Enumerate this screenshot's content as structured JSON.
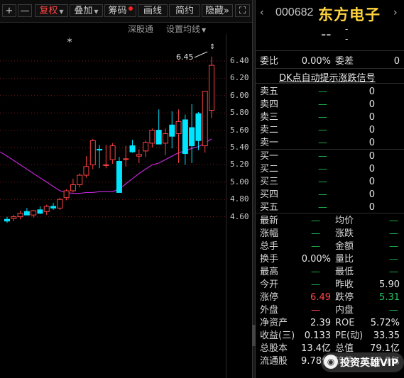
{
  "toolbar": {
    "plus": "+",
    "minus": "—",
    "fuquan": "复权",
    "diejia": "叠加",
    "chouma": "筹码",
    "huaxian": "画线",
    "jianyue": "简约",
    "yincang": "隐藏",
    "more": "»",
    "fullscreen": "⛶"
  },
  "subbar": {
    "shengutong": "深股通",
    "setting": "设置均线"
  },
  "chart": {
    "y_ticks": [
      "6.40",
      "6.20",
      "6.00",
      "5.80",
      "5.60",
      "5.40",
      "5.20",
      "5.00",
      "4.80",
      "4.60"
    ],
    "high_label": "6.45",
    "star": "*",
    "chart_data": {
      "type": "candlestick",
      "ylim": [
        4.56,
        6.48
      ],
      "candles": [
        {
          "o": 4.57,
          "h": 4.6,
          "l": 4.53,
          "c": 4.55
        },
        {
          "o": 4.58,
          "h": 4.62,
          "l": 4.55,
          "c": 4.6
        },
        {
          "o": 4.6,
          "h": 4.67,
          "l": 4.57,
          "c": 4.64
        },
        {
          "o": 4.66,
          "h": 4.7,
          "l": 4.62,
          "c": 4.62
        },
        {
          "o": 4.62,
          "h": 4.68,
          "l": 4.59,
          "c": 4.67
        },
        {
          "o": 4.68,
          "h": 4.72,
          "l": 4.63,
          "c": 4.64
        },
        {
          "o": 4.66,
          "h": 4.74,
          "l": 4.62,
          "c": 4.72
        },
        {
          "o": 4.72,
          "h": 4.76,
          "l": 4.68,
          "c": 4.7
        },
        {
          "o": 4.7,
          "h": 4.82,
          "l": 4.68,
          "c": 4.8
        },
        {
          "o": 4.82,
          "h": 4.92,
          "l": 4.79,
          "c": 4.9
        },
        {
          "o": 4.9,
          "h": 5.04,
          "l": 4.88,
          "c": 4.97
        },
        {
          "o": 4.97,
          "h": 5.1,
          "l": 4.94,
          "c": 5.08
        },
        {
          "o": 5.08,
          "h": 5.3,
          "l": 5.05,
          "c": 5.18
        },
        {
          "o": 5.2,
          "h": 5.5,
          "l": 5.15,
          "c": 5.48
        },
        {
          "o": 5.38,
          "h": 5.43,
          "l": 5.16,
          "c": 5.37
        },
        {
          "o": 5.2,
          "h": 5.43,
          "l": 5.16,
          "c": 5.2
        },
        {
          "o": 5.26,
          "h": 5.45,
          "l": 5.21,
          "c": 5.42
        },
        {
          "o": 5.24,
          "h": 5.29,
          "l": 4.88,
          "c": 4.88
        },
        {
          "o": 5.27,
          "h": 5.42,
          "l": 5.18,
          "c": 5.27
        },
        {
          "o": 5.42,
          "h": 5.49,
          "l": 5.34,
          "c": 5.35
        },
        {
          "o": 5.3,
          "h": 5.38,
          "l": 5.22,
          "c": 5.32
        },
        {
          "o": 5.36,
          "h": 5.48,
          "l": 5.29,
          "c": 5.46
        },
        {
          "o": 5.45,
          "h": 5.62,
          "l": 5.4,
          "c": 5.6
        },
        {
          "o": 5.6,
          "h": 5.84,
          "l": 5.55,
          "c": 5.44
        },
        {
          "o": 5.45,
          "h": 5.62,
          "l": 5.31,
          "c": 5.56
        },
        {
          "o": 5.66,
          "h": 5.82,
          "l": 5.39,
          "c": 5.53
        },
        {
          "o": 5.56,
          "h": 5.84,
          "l": 5.22,
          "c": 5.7
        },
        {
          "o": 5.72,
          "h": 5.78,
          "l": 5.2,
          "c": 5.33
        },
        {
          "o": 5.63,
          "h": 5.9,
          "l": 5.22,
          "c": 5.42
        },
        {
          "o": 5.79,
          "h": 5.81,
          "l": 5.37,
          "c": 5.48
        },
        {
          "o": 5.42,
          "h": 6.05,
          "l": 5.34,
          "c": 6.05
        },
        {
          "o": 5.83,
          "h": 6.45,
          "l": 5.74,
          "c": 6.35
        }
      ],
      "ma": [
        5.3,
        5.25,
        5.2,
        5.15,
        5.1,
        5.05,
        5.0,
        4.95,
        4.9,
        4.88,
        4.87,
        4.87,
        4.88,
        4.88,
        4.89,
        4.89,
        4.89,
        4.92,
        4.98,
        5.04,
        5.1,
        5.15,
        5.2,
        5.22,
        5.26,
        5.3,
        5.34,
        5.36,
        5.39,
        5.41,
        5.45,
        5.5
      ]
    }
  },
  "panel": {
    "prev": "‹",
    "next": "›",
    "code": "000682",
    "name": "东方电子",
    "price_dash": "--",
    "change_dash": "-",
    "pct_dash": "-",
    "weibi_label": "委比",
    "weibi_value": "0.00%",
    "weicha_label": "委差",
    "weicha_value": "0",
    "dk_text": "DK点自动提示涨跌信号",
    "asks": [
      {
        "label": "卖五",
        "price": "—",
        "vol": "0"
      },
      {
        "label": "卖四",
        "price": "—",
        "vol": "0"
      },
      {
        "label": "卖三",
        "price": "—",
        "vol": "0"
      },
      {
        "label": "卖二",
        "price": "—",
        "vol": "0"
      },
      {
        "label": "卖一",
        "price": "—",
        "vol": "0"
      }
    ],
    "bids": [
      {
        "label": "买一",
        "price": "—",
        "vol": "0"
      },
      {
        "label": "买二",
        "price": "—",
        "vol": "0"
      },
      {
        "label": "买三",
        "price": "—",
        "vol": "0"
      },
      {
        "label": "买四",
        "price": "—",
        "vol": "0"
      },
      {
        "label": "买五",
        "price": "—",
        "vol": "0"
      }
    ],
    "stats": [
      {
        "l1": "最新",
        "v1": "—",
        "l2": "均价",
        "v2": "—"
      },
      {
        "l1": "涨幅",
        "v1": "—",
        "l2": "涨跌",
        "v2": "—"
      },
      {
        "l1": "总手",
        "v1": "—",
        "l2": "金额",
        "v2": "—"
      },
      {
        "l1": "换手",
        "v1": "0.00%",
        "l2": "量比",
        "v2": "—"
      },
      {
        "l1": "最高",
        "v1": "—",
        "l2": "最低",
        "v2": "—"
      },
      {
        "l1": "今开",
        "v1": "—",
        "l2": "昨收",
        "v2": "5.90"
      },
      {
        "l1": "涨停",
        "v1": "6.49",
        "l2": "跌停",
        "v2": "5.31"
      },
      {
        "l1": "外盘",
        "v1": "—",
        "l2": "内盘",
        "v2": "—"
      },
      {
        "l1": "净资产",
        "v1": "2.39",
        "l2": "ROE",
        "v2": "5.72%"
      },
      {
        "l1": "收益(三)",
        "v1": "0.133",
        "l2": "PE(动)",
        "v2": "33.35"
      },
      {
        "l1": "总股本",
        "v1": "13.4亿",
        "l2": "总值",
        "v2": "79.1亿"
      },
      {
        "l1": "流通股",
        "v1": "9.78亿",
        "l2": "流值",
        "v2": "57.7亿"
      }
    ],
    "watermark_icon": "◉",
    "watermark_text": "投资英雄VIP"
  },
  "colors": {
    "up": "#ff4444",
    "down": "#00e5ff",
    "ma": "#c026d3",
    "grid": "#7a1a1a",
    "name": "#ffd23f"
  }
}
